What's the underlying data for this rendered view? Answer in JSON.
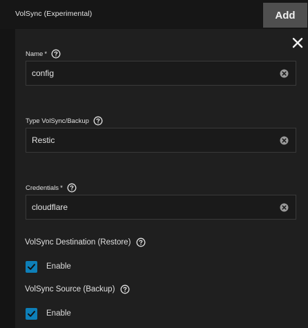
{
  "header": {
    "title": "VolSync (Experimental)",
    "add_label": "Add"
  },
  "fields": {
    "name": {
      "label": "Name",
      "required_mark": "*",
      "value": "config"
    },
    "type": {
      "label": "Type VolSync/Backup",
      "value": "Restic"
    },
    "credentials": {
      "label": "Credentials",
      "required_mark": "*",
      "value": "cloudflare"
    }
  },
  "destination": {
    "label": "VolSync Destination (Restore)",
    "enable_label": "Enable",
    "checked": true
  },
  "source": {
    "label": "VolSync Source (Backup)",
    "enable_label": "Enable",
    "checked": true
  },
  "colors": {
    "accent_checkbox": "#0e7fb8",
    "card_bg": "#1f1f1f",
    "page_bg": "#141414",
    "add_button_bg": "#4f4f4f"
  }
}
